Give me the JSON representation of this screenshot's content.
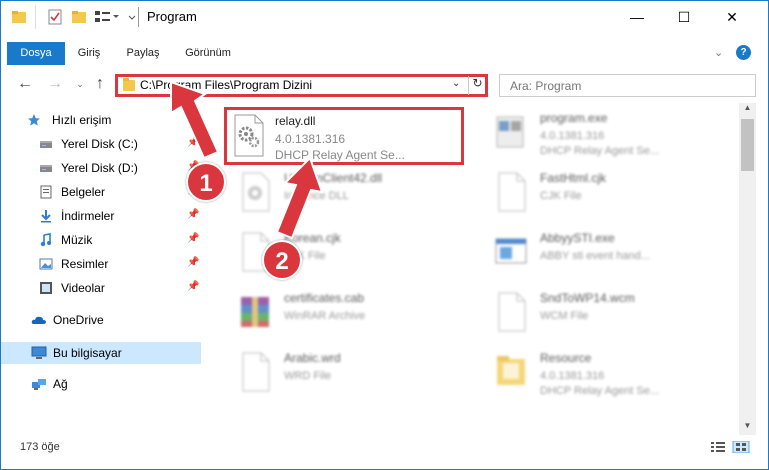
{
  "window": {
    "title": "Program",
    "controls": {
      "minimize": "—",
      "maximize": "☐",
      "close": "✕"
    }
  },
  "ribbon": {
    "tabs": [
      {
        "label": "Dosya",
        "active": true
      },
      {
        "label": "Giriş"
      },
      {
        "label": "Paylaş"
      },
      {
        "label": "Görünüm"
      }
    ]
  },
  "navigation": {
    "address": "C:\\Program Files\\Program Dizini",
    "search_placeholder": "Ara: Program"
  },
  "sidebar": {
    "items": [
      {
        "label": "Hızlı erişim",
        "icon": "star-icon",
        "pinned": false
      },
      {
        "label": "Yerel Disk (C:)",
        "icon": "drive-icon",
        "pinned": true
      },
      {
        "label": "Yerel Disk (D:)",
        "icon": "drive-icon",
        "pinned": true
      },
      {
        "label": "Belgeler",
        "icon": "documents-icon",
        "pinned": true
      },
      {
        "label": "İndirmeler",
        "icon": "download-icon",
        "pinned": true
      },
      {
        "label": "Müzik",
        "icon": "music-icon",
        "pinned": true
      },
      {
        "label": "Resimler",
        "icon": "pictures-icon",
        "pinned": true
      },
      {
        "label": "Videolar",
        "icon": "video-icon",
        "pinned": true
      },
      {
        "label": "OneDrive",
        "icon": "cloud-icon",
        "pinned": false
      },
      {
        "label": "Bu bilgisayar",
        "icon": "computer-icon",
        "pinned": false,
        "selected": true
      },
      {
        "label": "Ağ",
        "icon": "network-icon",
        "pinned": false
      }
    ]
  },
  "files": [
    {
      "name": "relay.dll",
      "line1": "4.0.1381.316",
      "line2": "DHCP Relay Agent Se...",
      "icon": "dll-gear-icon",
      "highlighted": true
    },
    {
      "name": "program.exe",
      "line1": "4.0.1381.316",
      "line2": "DHCP Relay Agent Se...",
      "icon": "exe-icon"
    },
    {
      "name": "UrlMonClient42.dll",
      "line1": "Instance DLL",
      "line2": "",
      "icon": "dll-gear-icon"
    },
    {
      "name": "FastHtml.cjk",
      "line1": "CJK File",
      "line2": "",
      "icon": "blank-file-icon"
    },
    {
      "name": "Korean.cjk",
      "line1": "CJK File",
      "line2": "",
      "icon": "blank-file-icon"
    },
    {
      "name": "AbbyySTI.exe",
      "line1": "ABBY sti event hand...",
      "line2": "",
      "icon": "app-window-icon"
    },
    {
      "name": "certificates.cab",
      "line1": "WinRAR Archive",
      "line2": "",
      "icon": "archive-icon"
    },
    {
      "name": "SndToWP14.wcm",
      "line1": "WCM File",
      "line2": "",
      "icon": "blank-file-icon"
    },
    {
      "name": "Arabic.wrd",
      "line1": "WRD File",
      "line2": "",
      "icon": "blank-file-icon"
    },
    {
      "name": "Resource",
      "line1": "4.0.1381.316",
      "line2": "DHCP Relay Agent Se...",
      "icon": "folder-icon"
    }
  ],
  "status": {
    "count": "173 öğe"
  },
  "callouts": [
    "1",
    "2"
  ],
  "colors": {
    "accent": "#1979ca",
    "highlight_red": "#d9363e",
    "selected_bg": "#cce8ff"
  }
}
